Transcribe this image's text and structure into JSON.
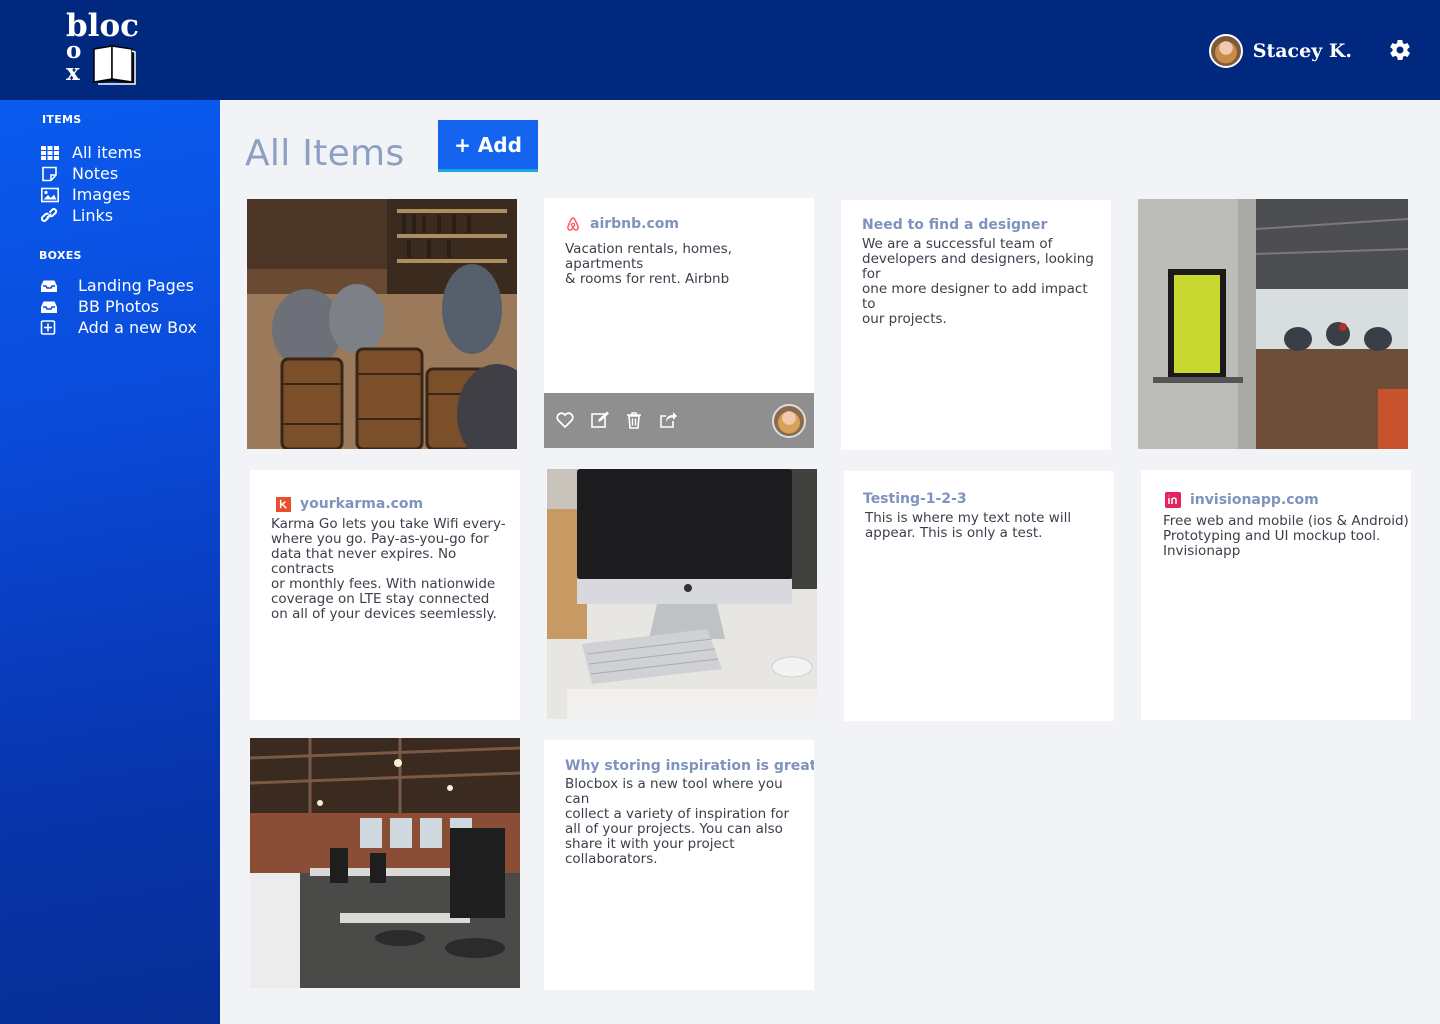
{
  "brand": {
    "line1": "bloc",
    "line2": "o",
    "line3": "x"
  },
  "user": {
    "name": "Stacey K."
  },
  "sidebar": {
    "items_title": "ITEMS",
    "items": [
      {
        "label": "All items",
        "icon": "grid-icon"
      },
      {
        "label": "Notes",
        "icon": "note-icon"
      },
      {
        "label": "Images",
        "icon": "image-icon"
      },
      {
        "label": "Links",
        "icon": "link-icon"
      }
    ],
    "boxes_title": "BOXES",
    "boxes": [
      {
        "label": "Landing Pages",
        "icon": "inbox-icon"
      },
      {
        "label": "BB Photos",
        "icon": "inbox-icon"
      },
      {
        "label": "Add a new Box",
        "icon": "plus-square-icon"
      }
    ]
  },
  "main": {
    "title": "All Items",
    "add_label": "+ Add",
    "cards": [
      {
        "type": "image",
        "subject": "wine bar with barrels"
      },
      {
        "type": "link",
        "title": "airbnb.com",
        "icon": "airbnb-icon",
        "body": "Vacation rentals, homes, apartments\n& rooms for rent. Airbnb"
      },
      {
        "type": "note",
        "title": "Need to find a designer",
        "body": "We are a successful team of\ndevelopers and designers, looking for\none more designer to add impact to\nour projects."
      },
      {
        "type": "image",
        "subject": "office with poster"
      },
      {
        "type": "link",
        "title": "yourkarma.com",
        "icon": "karma-icon",
        "body": "Karma Go lets you take Wifi every-\nwhere you go. Pay-as-you-go for\ndata that never expires. No contracts\nor monthly fees. With nationwide\ncoverage on LTE stay connected\non all of your devices seemlessly."
      },
      {
        "type": "image",
        "subject": "desktop computer on desk"
      },
      {
        "type": "note",
        "title": "Testing-1-2-3",
        "body": "This is where my text note will\nappear.  This is only a test."
      },
      {
        "type": "link",
        "title": "invisionapp.com",
        "icon": "invision-icon",
        "body": "Free web and mobile (ios & Android)\nPrototyping and UI mockup tool.\nInvisionapp"
      },
      {
        "type": "image",
        "subject": "open plan office"
      },
      {
        "type": "note",
        "title": "Why storing inspiration is great",
        "body": "Blocbox is a new tool where you can\ncollect a variety of inspiration for\nall of your projects.  You can also\nshare it with your project\ncollaborators."
      }
    ],
    "card_actions": [
      "heart-icon",
      "edit-icon",
      "trash-icon",
      "share-icon"
    ]
  },
  "colors": {
    "header": "#00287f",
    "sidebar": "#0a4ad9",
    "accent": "#1464f0",
    "title": "#8ba0c2",
    "card_title": "#7e93bd"
  }
}
